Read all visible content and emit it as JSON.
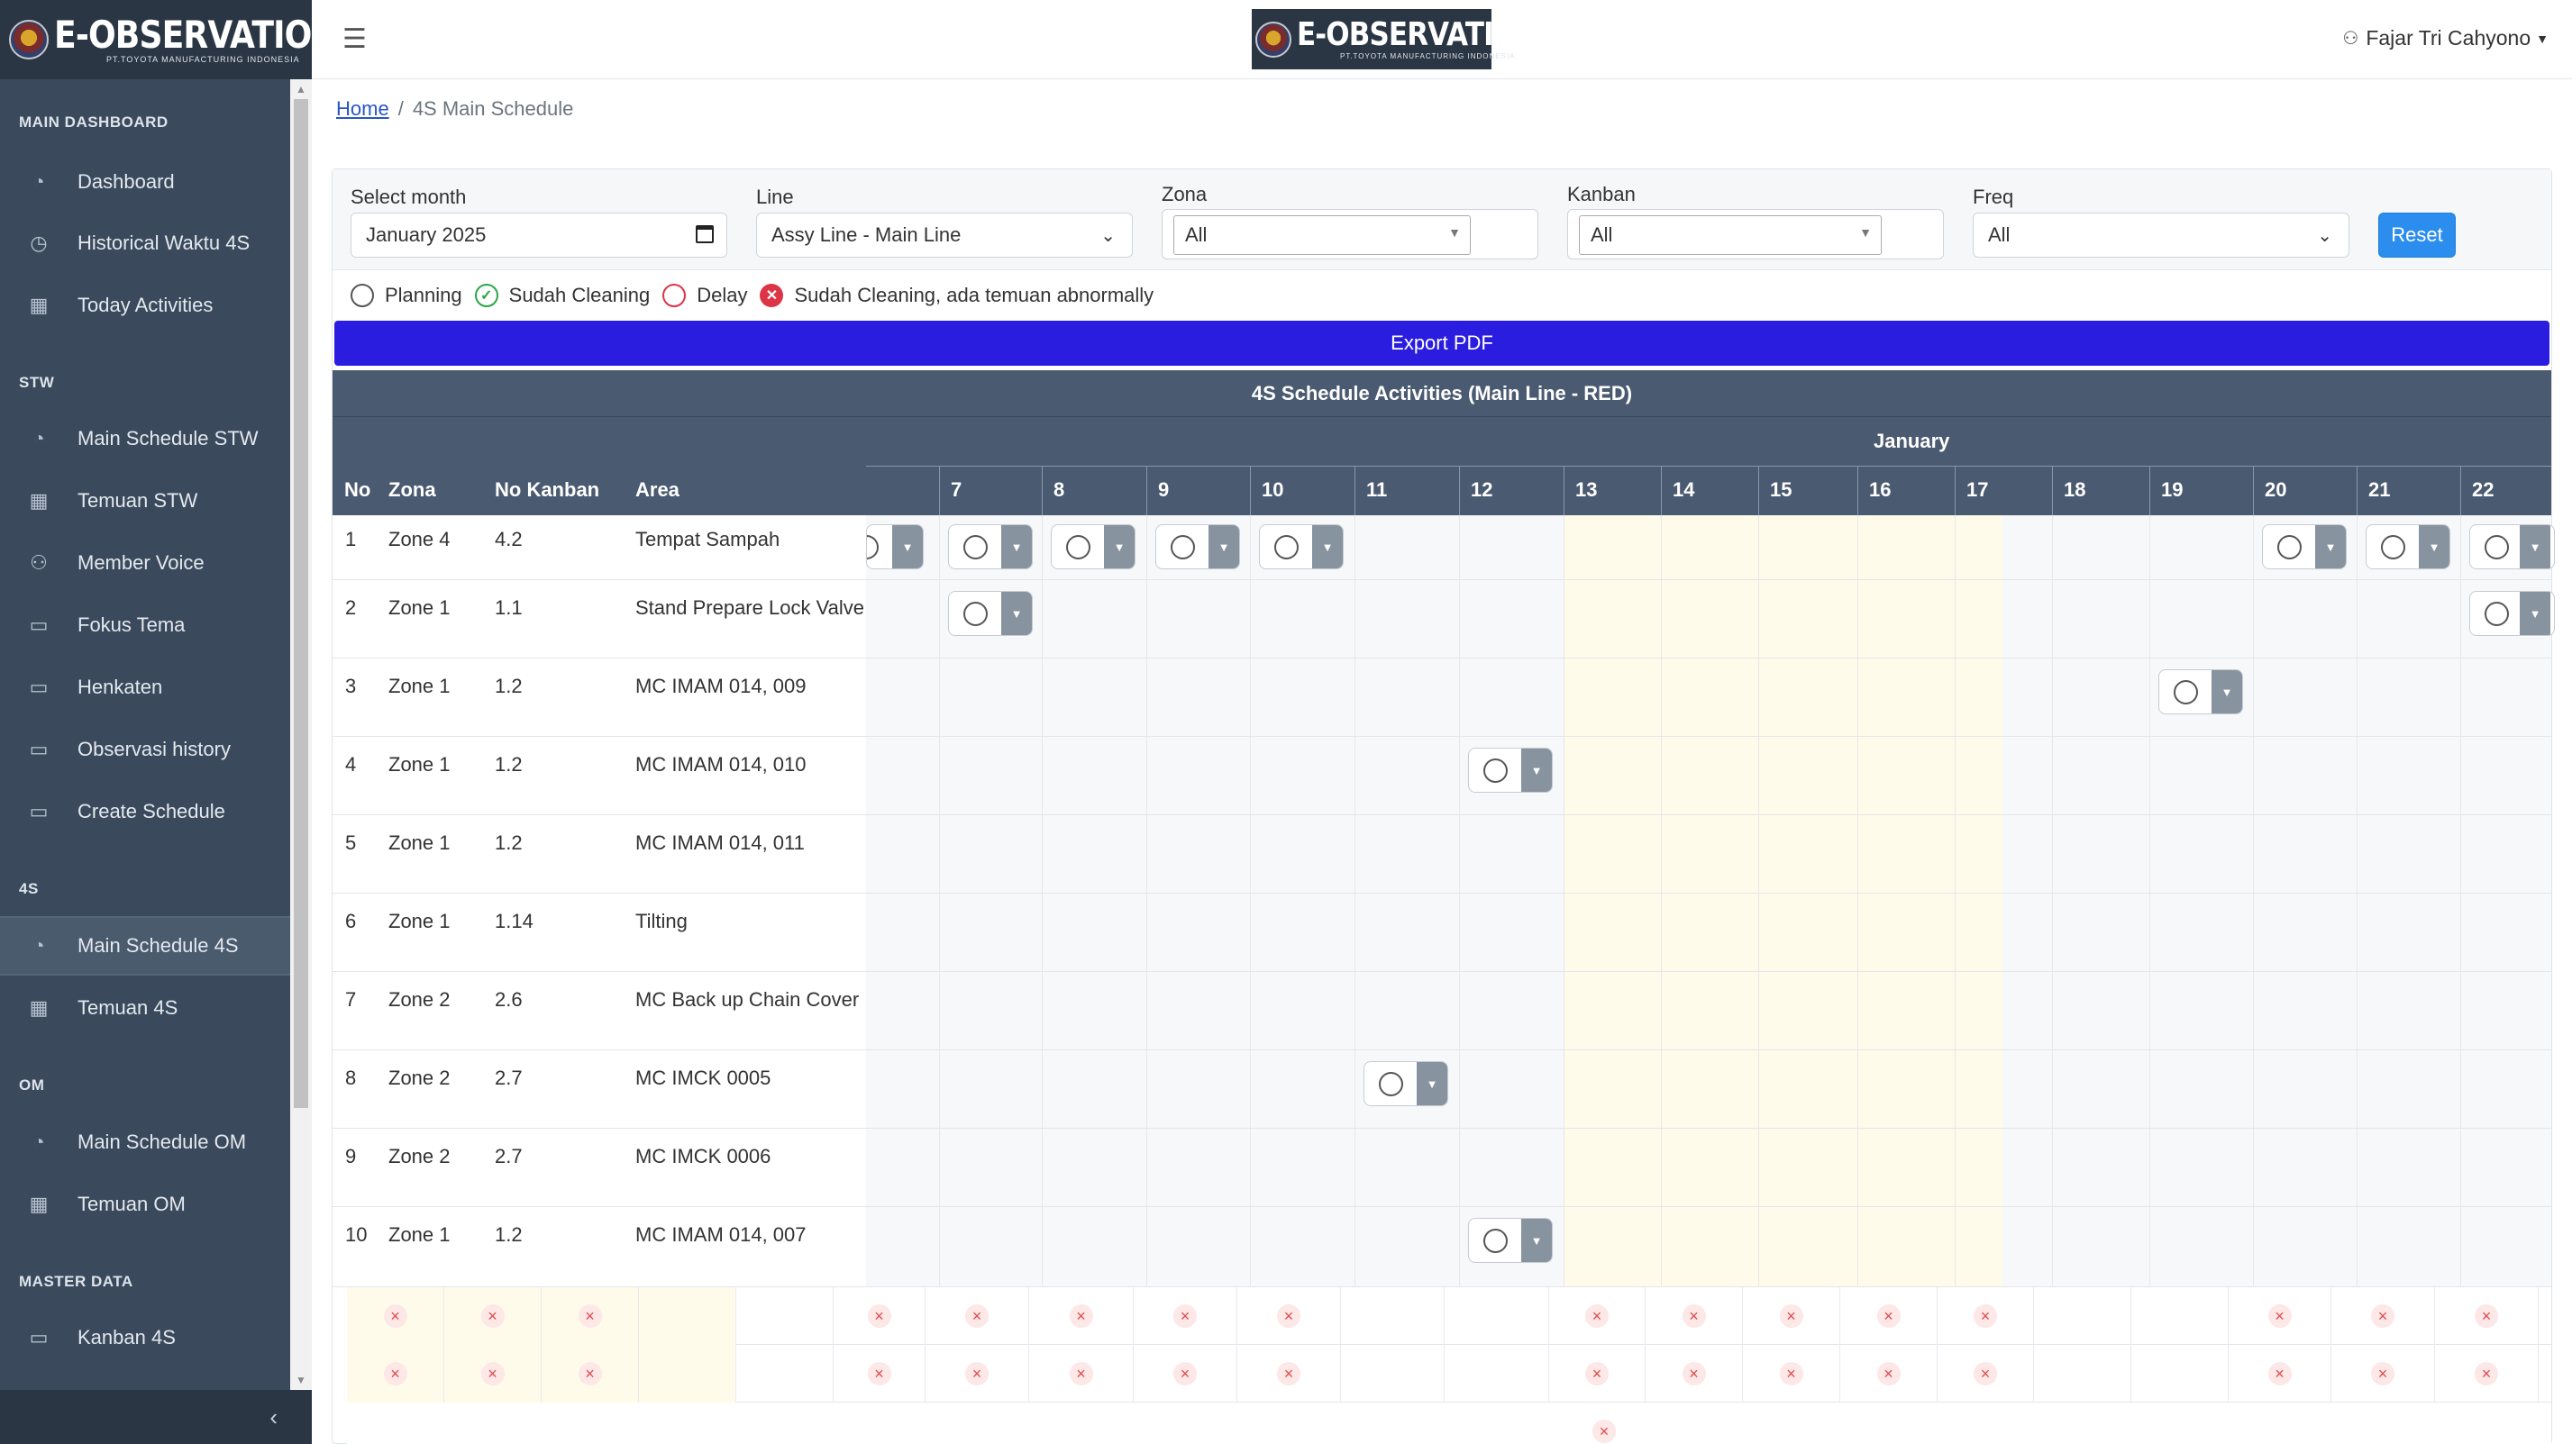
{
  "app": {
    "brand_title": "E-OBSERVATION",
    "brand_subtitle": "PT.TOYOTA MANUFACTURING INDONESIA"
  },
  "sidebar": {
    "sections": [
      {
        "heading": "MAIN DASHBOARD",
        "items": [
          {
            "label": "Dashboard",
            "icon": "dashboard-icon"
          },
          {
            "label": "Historical Waktu 4S",
            "icon": "history-icon"
          },
          {
            "label": "Today Activities",
            "icon": "calendar-icon"
          }
        ]
      },
      {
        "heading": "STW",
        "items": [
          {
            "label": "Main Schedule STW",
            "icon": "dashboard-icon"
          },
          {
            "label": "Temuan STW",
            "icon": "table-icon"
          },
          {
            "label": "Member Voice",
            "icon": "user-icon"
          },
          {
            "label": "Fokus Tema",
            "icon": "clipboard-icon"
          },
          {
            "label": "Henkaten",
            "icon": "clipboard-icon"
          },
          {
            "label": "Observasi history",
            "icon": "clipboard-icon"
          },
          {
            "label": "Create Schedule",
            "icon": "clipboard-icon"
          }
        ]
      },
      {
        "heading": "4S",
        "items": [
          {
            "label": "Main Schedule 4S",
            "icon": "dashboard-icon",
            "active": true
          },
          {
            "label": "Temuan 4S",
            "icon": "table-icon"
          }
        ]
      },
      {
        "heading": "OM",
        "items": [
          {
            "label": "Main Schedule OM",
            "icon": "dashboard-icon"
          },
          {
            "label": "Temuan OM",
            "icon": "table-icon"
          }
        ]
      },
      {
        "heading": "MASTER DATA",
        "items": [
          {
            "label": "Kanban 4S",
            "icon": "clipboard-icon"
          }
        ]
      }
    ],
    "collapse_icon": "chevron-left-icon"
  },
  "topbar": {
    "menu_icon": "hamburger-icon",
    "user_name": "Fajar Tri Cahyono",
    "user_icon": "user-icon"
  },
  "breadcrumb": {
    "home": "Home",
    "current": "4S Main Schedule"
  },
  "filters": {
    "month": {
      "label": "Select month",
      "value": "January 2025"
    },
    "line": {
      "label": "Line",
      "value": "Assy Line - Main Line"
    },
    "zona": {
      "label": "Zona",
      "value": "All"
    },
    "kanban": {
      "label": "Kanban",
      "value": "All"
    },
    "freq": {
      "label": "Freq",
      "value": "All"
    },
    "reset_label": "Reset"
  },
  "legend": {
    "planning": "Planning",
    "done": "Sudah Cleaning",
    "delay": "Delay",
    "abnormal": "Sudah Cleaning, ada temuan abnormally"
  },
  "export_label": "Export PDF",
  "table": {
    "title": "4S Schedule Activities (Main Line - RED)",
    "month": "January",
    "columns": {
      "no": "No",
      "zona": "Zona",
      "kanban": "No Kanban",
      "area": "Area"
    },
    "days": [
      "7",
      "8",
      "9",
      "10",
      "11",
      "12",
      "13",
      "14",
      "15",
      "16",
      "17",
      "18",
      "19",
      "20",
      "21",
      "22"
    ],
    "rows": [
      {
        "no": "1",
        "zona": "Zone 4",
        "kanban": "4.2",
        "area": "Tempat Sampah"
      },
      {
        "no": "2",
        "zona": "Zone 1",
        "kanban": "1.1",
        "area": "Stand Prepare Lock Valve"
      },
      {
        "no": "3",
        "zona": "Zone 1",
        "kanban": "1.2",
        "area": "MC IMAM 014, 009"
      },
      {
        "no": "4",
        "zona": "Zone 1",
        "kanban": "1.2",
        "area": "MC IMAM 014, 010"
      },
      {
        "no": "5",
        "zona": "Zone 1",
        "kanban": "1.2",
        "area": "MC IMAM 014, 011"
      },
      {
        "no": "6",
        "zona": "Zone 1",
        "kanban": "1.14",
        "area": "Tilting"
      },
      {
        "no": "7",
        "zona": "Zone 2",
        "kanban": "2.6",
        "area": "MC Back up Chain Cover"
      },
      {
        "no": "8",
        "zona": "Zone 2",
        "kanban": "2.7",
        "area": "MC IMCK 0005"
      },
      {
        "no": "9",
        "zona": "Zone 2",
        "kanban": "2.7",
        "area": "MC IMCK 0006"
      },
      {
        "no": "10",
        "zona": "Zone 1",
        "kanban": "1.2",
        "area": "MC IMAM 014, 007"
      }
    ],
    "schedule": [
      {
        "row": 1,
        "days": [
          "6",
          "7",
          "8",
          "9",
          "10",
          "20",
          "21",
          "22"
        ],
        "status": "planning"
      },
      {
        "row": 2,
        "days": [
          "7",
          "22"
        ],
        "status": "planning"
      },
      {
        "row": 3,
        "days": [
          "19"
        ],
        "status": "planning"
      },
      {
        "row": 4,
        "days": [
          "12"
        ],
        "status": "planning"
      },
      {
        "row": 8,
        "days": [
          "11"
        ],
        "status": "planning"
      },
      {
        "row": 10,
        "days": [
          "12"
        ],
        "status": "planning"
      }
    ]
  }
}
